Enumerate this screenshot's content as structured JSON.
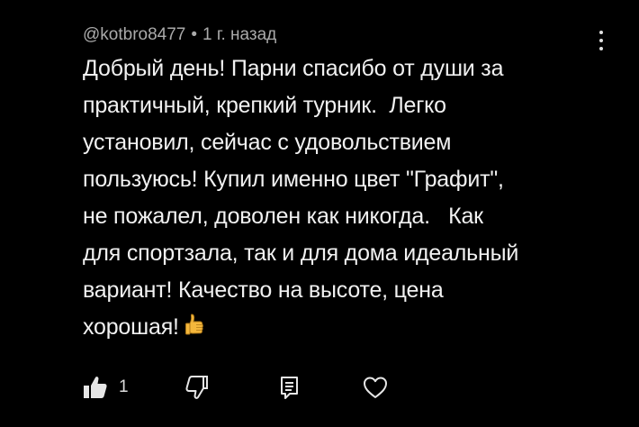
{
  "comment": {
    "author": "@kotbro8477",
    "separator": "•",
    "time": "1 г. назад",
    "text": "Добрый день! Парни спасибо от души за\nпрактичный, крепкий турник.  Легко\nустановил, сейчас с удовольствием\nпользуюсь! Купил именно цвет \"Графит\",\nне пожалел, доволен как никогда.   Как\nдля спортзала, так и для дома идеальный\nвариант! Качество на высоте, цена\nхорошая!",
    "emoji": "thumbs-up-emoji"
  },
  "actions": {
    "like_count": "1",
    "icons": [
      "thumbs-up-icon",
      "thumbs-down-icon",
      "reply-icon",
      "heart-icon"
    ]
  },
  "menu": {
    "icon": "more-vertical-icon"
  },
  "colors": {
    "background": "#000000",
    "text": "#f1f1f1",
    "secondary": "#aaaaaa",
    "emoji": "#f4b73c"
  }
}
